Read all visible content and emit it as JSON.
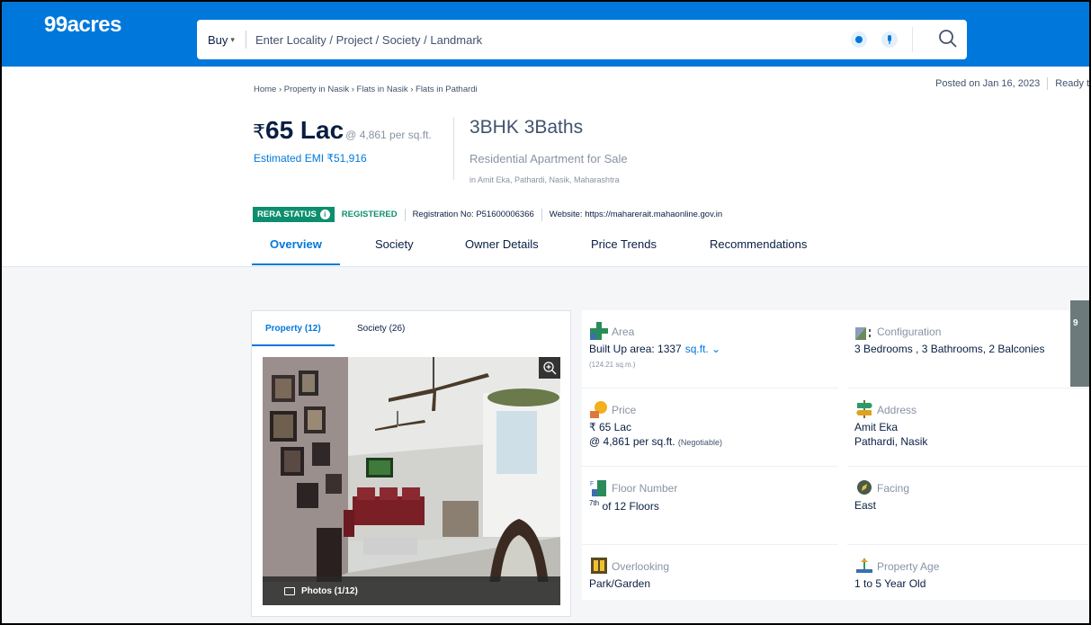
{
  "header": {
    "logo": "99acres",
    "buy_label": "Buy",
    "search_placeholder": "Enter Locality / Project / Society / Landmark"
  },
  "posted": {
    "date": "Posted on Jan 16, 2023",
    "status": "Ready to"
  },
  "breadcrumb": "Home › Property in Nasik › Flats in Nasik › Flats in Pathardi",
  "listing": {
    "price_symbol": "₹",
    "price": "65 Lac",
    "price_per_sqft": "@ 4,861 per sq.ft.",
    "emi": "Estimated EMI ₹51,916",
    "bhk": "3BHK 3Baths",
    "type": "Residential Apartment for Sale",
    "location": "in Amit Eka, Pathardi, Nasik, Maharashtra"
  },
  "rera": {
    "badge": "RERA STATUS",
    "status": "REGISTERED",
    "registration": "Registration No: P51600006366",
    "website": "Website: https://maharerait.mahaonline.gov.in"
  },
  "tabs": [
    "Overview",
    "Society",
    "Owner Details",
    "Price Trends",
    "Recommendations"
  ],
  "photo_tabs": [
    "Property (12)",
    "Society (26)"
  ],
  "photos_label": "Photos (1/12)",
  "details": {
    "area": {
      "label": "Area",
      "value": "Built Up area: 1337",
      "unit": "sq.ft.",
      "sub": "(124.21 sq.m.)"
    },
    "configuration": {
      "label": "Configuration",
      "value": "3 Bedrooms , 3 Bathrooms, 2 Balconies"
    },
    "price": {
      "label": "Price",
      "value": "₹ 65 Lac",
      "value2": "@ 4,861 per sq.ft.",
      "note": "(Negotiable)"
    },
    "address": {
      "label": "Address",
      "value": "Amit Eka",
      "value2": "Pathardi, Nasik"
    },
    "floor": {
      "label": "Floor Number",
      "value_sup": "7th",
      "value": "of 12 Floors"
    },
    "facing": {
      "label": "Facing",
      "value": "East"
    },
    "overlooking": {
      "label": "Overlooking",
      "value": "Park/Garden"
    },
    "age": {
      "label": "Property Age",
      "value": "1 to 5 Year Old"
    }
  },
  "colors": {
    "brand": "#0078db",
    "rera_green": "#0d8f6f"
  }
}
